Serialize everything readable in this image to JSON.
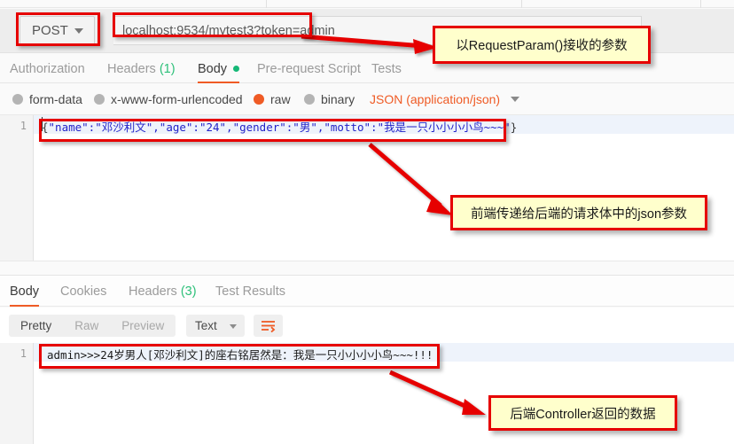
{
  "request": {
    "method": "POST",
    "url": "localhost:9534/mytest3?token=admin",
    "tabs": [
      {
        "label": "Authorization",
        "active": false,
        "count": "",
        "dot": false
      },
      {
        "label": "Headers",
        "active": false,
        "count": "(1)",
        "dot": false
      },
      {
        "label": "Body",
        "active": true,
        "count": "",
        "dot": true
      },
      {
        "label": "Pre-request Script",
        "active": false,
        "count": "",
        "dot": false
      },
      {
        "label": "Tests",
        "active": false,
        "count": "",
        "dot": false
      }
    ],
    "body_types": [
      {
        "label": "form-data",
        "selected": false
      },
      {
        "label": "x-www-form-urlencoded",
        "selected": false
      },
      {
        "label": "raw",
        "selected": true
      },
      {
        "label": "binary",
        "selected": false
      }
    ],
    "content_type": "JSON (application/json)",
    "editor": {
      "line_number": "1",
      "code_prefix": "{",
      "code_body": "\"name\":\"邓沙利文\",\"age\":\"24\",\"gender\":\"男\",\"motto\":\"我是一只小小小小鸟~~~\"",
      "code_suffix": "}",
      "full_code": "{\"name\":\"邓沙利文\",\"age\":\"24\",\"gender\":\"男\",\"motto\":\"我是一只小小小小鸟~~~\"}"
    }
  },
  "response": {
    "tabs": [
      {
        "label": "Body",
        "active": true,
        "count": ""
      },
      {
        "label": "Cookies",
        "active": false,
        "count": ""
      },
      {
        "label": "Headers",
        "active": false,
        "count": "(3)"
      },
      {
        "label": "Test Results",
        "active": false,
        "count": ""
      }
    ],
    "view_modes": [
      {
        "label": "Pretty",
        "active": true
      },
      {
        "label": "Raw",
        "active": false
      },
      {
        "label": "Preview",
        "active": false
      }
    ],
    "format": "Text",
    "wrap_icon": "word-wrap-icon",
    "editor": {
      "line_number": "1",
      "text": "admin>>>24岁男人[邓沙利文]的座右铭居然是：我是一只小小小小鸟~~~!!!"
    }
  },
  "annotations": {
    "accent_red": "#e60000",
    "callout_bg": "#ffffcc",
    "callouts": [
      {
        "id": "param-note",
        "text": "以RequestParam()接收的参数"
      },
      {
        "id": "json-body-note",
        "text": "前端传递给后端的请求体中的json参数"
      },
      {
        "id": "controller-note",
        "text": "后端Controller返回的数据"
      }
    ],
    "highlights": [
      {
        "id": "method-highlight"
      },
      {
        "id": "url-highlight"
      },
      {
        "id": "request-body-highlight"
      },
      {
        "id": "response-body-highlight"
      }
    ]
  },
  "theme": {
    "orange": "#ef5b25",
    "green": "#16b877",
    "code_blue": "#2222c8"
  }
}
